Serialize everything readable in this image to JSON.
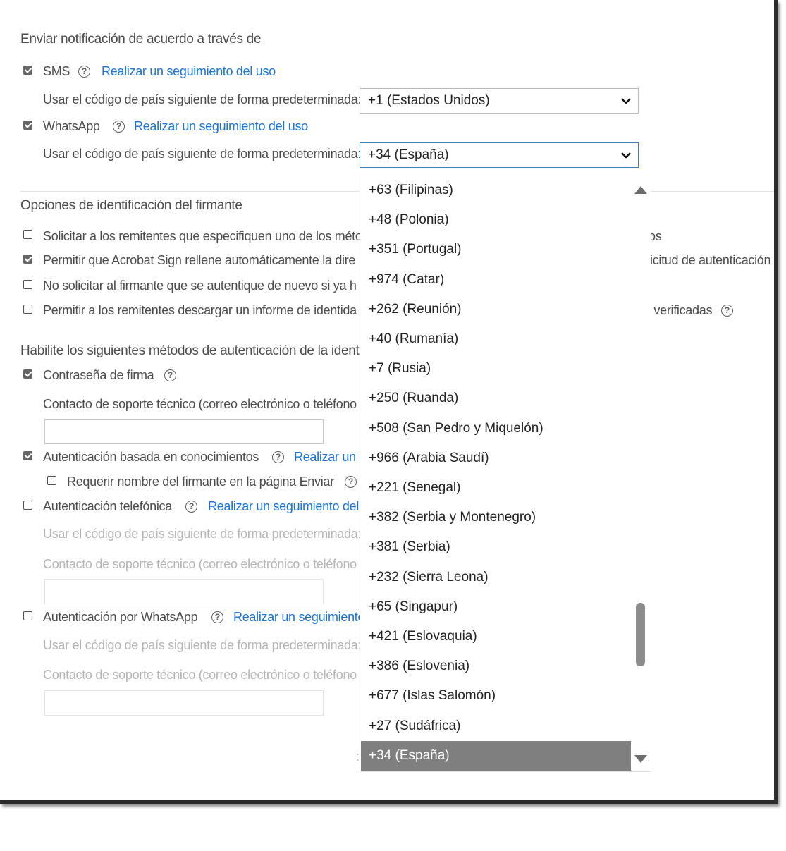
{
  "notify": {
    "heading": "Enviar notificación de acuerdo a través de",
    "sms_label": "SMS",
    "sms_link": "Realizar un seguimiento del uso",
    "sms_code_label": "Usar el código de país siguiente de forma predeterminada:",
    "sms_code_value": "+1 (Estados Unidos)",
    "whatsapp_label": "WhatsApp",
    "whatsapp_link": "Realizar un seguimiento del uso",
    "whatsapp_code_label": "Usar el código de país siguiente de forma predeterminada:",
    "whatsapp_code_value": "+34 (España)"
  },
  "identity": {
    "heading": "Opciones de identificación del firmante",
    "options": [
      {
        "left": "Solicitar a los remitentes que especifiquen uno de los méto",
        "right": "os",
        "checked": false
      },
      {
        "left": "Permitir que Acrobat Sign rellene automáticamente la dire",
        "right": "icitud de autenticación",
        "checked": true
      },
      {
        "left": "No solicitar al firmante que se autentique de nuevo si ya h",
        "right": "",
        "checked": false
      },
      {
        "left": "Permitir a los remitentes descargar un informe de identida",
        "right": "; verificadas",
        "checked": false
      }
    ]
  },
  "methods": {
    "heading": "Habilite los siguientes métodos de autenticación de la identi",
    "password_label": "Contraseña de firma",
    "support_contact_label": "Contacto de soporte técnico (correo electrónico o teléfono",
    "kba_label": "Autenticación basada en conocimientos",
    "kba_link": "Realizar un s",
    "require_name_label": "Requerir nombre del firmante en la página Enviar",
    "phone_label": "Autenticación telefónica",
    "phone_link": "Realizar un seguimiento del",
    "phone_code_label": "Usar el código de país siguiente de forma predeterminada:",
    "phone_support_label": "Contacto de soporte técnico (correo electrónico o teléfono",
    "wa_auth_label": "Autenticación por WhatsApp",
    "wa_auth_link": "Realizar un seguimiento",
    "wa_code_label": "Usar el código de país siguiente de forma predeterminada:",
    "wa_support_label": "Contacto de soporte técnico (correo electrónico o teléfono",
    "stray_colon": ":"
  },
  "dropdown": {
    "options": [
      "+63 (Filipinas)",
      "+48 (Polonia)",
      "+351 (Portugal)",
      "+974 (Catar)",
      "+262 (Reunión)",
      "+40 (Rumanía)",
      "+7 (Rusia)",
      "+250 (Ruanda)",
      "+508 (San Pedro y Miquelón)",
      "+966 (Arabia Saudí)",
      "+221 (Senegal)",
      "+382 (Serbia y Montenegro)",
      "+381 (Serbia)",
      "+232 (Sierra Leona)",
      "+65 (Singapur)",
      "+421 (Eslovaquia)",
      "+386 (Eslovenia)",
      "+677 (Islas Salomón)",
      "+27 (Sudáfrica)",
      "+34 (España)"
    ],
    "selected_index": 19
  },
  "colors": {
    "link": "#1a73d6",
    "selected_bg": "#7f7f7f",
    "focus_border": "#3a78b5"
  }
}
